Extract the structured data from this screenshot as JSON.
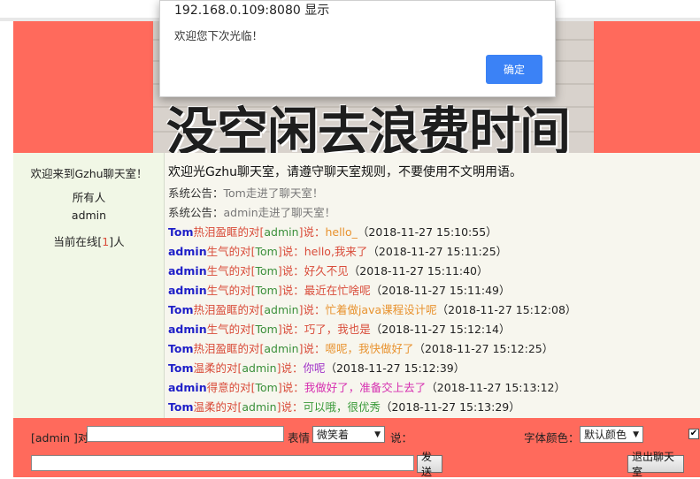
{
  "dialog": {
    "title": "192.168.0.109:8080 显示",
    "message": "欢迎您下次光临！",
    "ok_label": "确定"
  },
  "banner": {
    "text": "没空闲去浪费时间"
  },
  "sidebar": {
    "welcome": "欢迎来到Gzhu聊天室！",
    "users": [
      "所有人",
      "admin"
    ],
    "online_prefix": "当前在线[",
    "online_count": "1",
    "online_suffix": "]人"
  },
  "chat": {
    "header": "欢迎光Gzhu聊天室，请遵守聊天室规则，不要使用不文明用语。",
    "system_label": "系统公告：",
    "system_messages": [
      "Tom走进了聊天室！",
      "admin走进了聊天室！"
    ],
    "messages": [
      {
        "from": "Tom",
        "mood": "热泪盈眶",
        "to_word": "的对[",
        "target": "admin",
        "said": "]说：",
        "text": "hello_",
        "time": "（2018-11-27 15:10:55）",
        "color": "#e8922e"
      },
      {
        "from": "admin",
        "mood": "生气",
        "to_word": "的对[",
        "target": "Tom",
        "said": "]说：",
        "text": "hello,我来了",
        "time": "（2018-11-27 15:11:25）",
        "color": "#d94c3a"
      },
      {
        "from": "admin",
        "mood": "生气",
        "to_word": "的对[",
        "target": "Tom",
        "said": "]说：",
        "text": "好久不见",
        "time": "（2018-11-27 15:11:40）",
        "color": "#d94c3a"
      },
      {
        "from": "admin",
        "mood": "生气",
        "to_word": "的对[",
        "target": "Tom",
        "said": "]说：",
        "text": "最近在忙啥呢",
        "time": "（2018-11-27 15:11:49）",
        "color": "#d94c3a"
      },
      {
        "from": "Tom",
        "mood": "热泪盈眶",
        "to_word": "的对[",
        "target": "admin",
        "said": "]说：",
        "text": "忙着做java课程设计呢",
        "time": "（2018-11-27 15:12:08）",
        "color": "#e8922e"
      },
      {
        "from": "admin",
        "mood": "生气",
        "to_word": "的对[",
        "target": "Tom",
        "said": "]说：",
        "text": "巧了，我也是",
        "time": "（2018-11-27 15:12:14）",
        "color": "#d94c3a"
      },
      {
        "from": "Tom",
        "mood": "热泪盈眶",
        "to_word": "的对[",
        "target": "admin",
        "said": "]说：",
        "text": "嗯呢，我快做好了",
        "time": "（2018-11-27 15:12:25）",
        "color": "#e8922e"
      },
      {
        "from": "Tom",
        "mood": "温柔",
        "to_word": "的对[",
        "target": "admin",
        "said": "]说：",
        "text": "你呢",
        "time": "（2018-11-27 15:12:39）",
        "color": "#a033c8"
      },
      {
        "from": "admin",
        "mood": "得意",
        "to_word": "的对[",
        "target": "Tom",
        "said": "]说：",
        "text": "我做好了，准备交上去了",
        "time": "（2018-11-27 15:13:12）",
        "color": "#d62fb0"
      },
      {
        "from": "Tom",
        "mood": "温柔",
        "to_word": "的对[",
        "target": "admin",
        "said": "]说：",
        "text": "可以哦，很优秀",
        "time": "（2018-11-27 15:13:29）",
        "color": "#3a9a3a"
      }
    ]
  },
  "footer": {
    "user_label": "[admin ]对",
    "target_value": "",
    "expression_label": "表情",
    "expression_selected": "微笑着",
    "say_label": "说：",
    "font_color_label": "字体颜色：",
    "font_color_selected": "默认颜色",
    "message_value": "",
    "send_label": "发送",
    "exit_label": "退出聊天室",
    "checkbox_checked": "✔"
  }
}
